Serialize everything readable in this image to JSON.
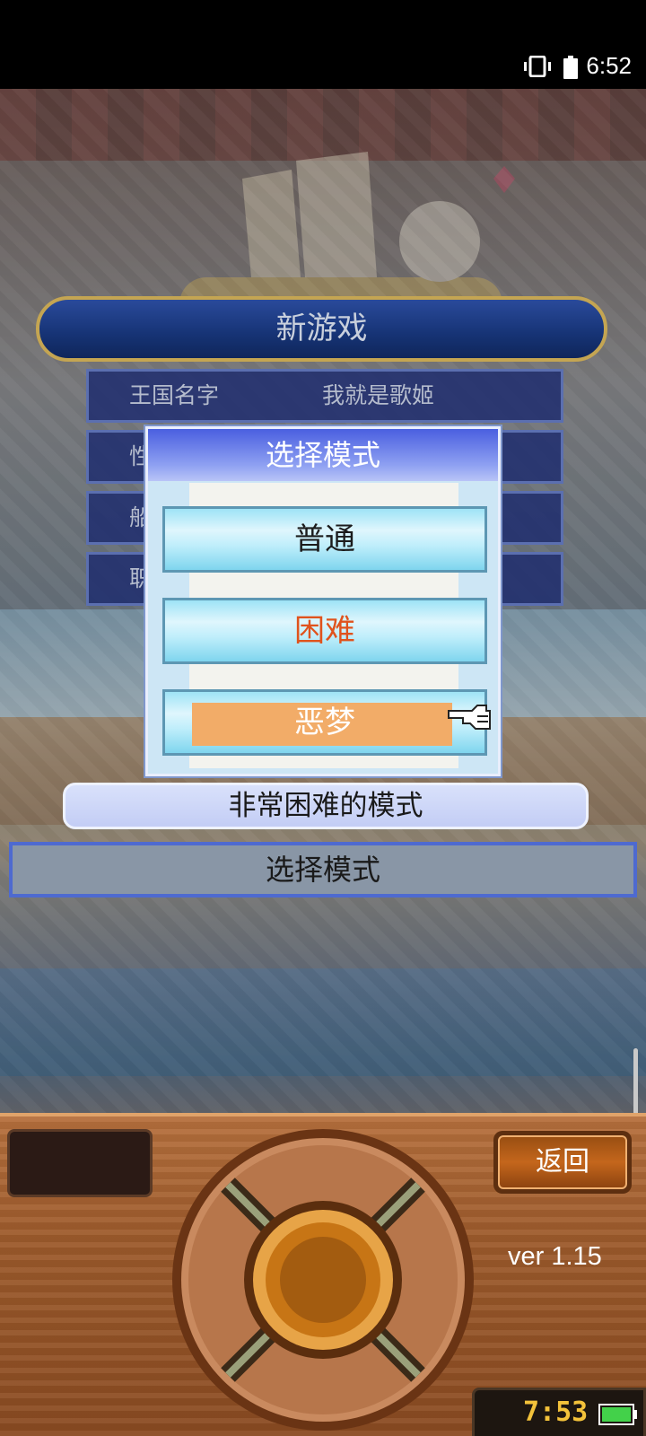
{
  "status_bar": {
    "time": "6:52"
  },
  "new_game": {
    "title": "新游戏",
    "rows": [
      {
        "label": "王国名字",
        "value": "我就是歌姬"
      },
      {
        "label": "性",
        "value": ""
      },
      {
        "label": "船",
        "value": ""
      },
      {
        "label": "职",
        "value": ""
      }
    ]
  },
  "mode_dialog": {
    "title": "选择模式",
    "options": [
      {
        "label": "普通",
        "state": "normal"
      },
      {
        "label": "困难",
        "state": "hard"
      },
      {
        "label": "恶梦",
        "state": "selected"
      }
    ]
  },
  "description": "非常困难的模式",
  "footer": "选择模式",
  "console": {
    "back_label": "返回",
    "version": "ver 1.15",
    "clock": "7:53"
  },
  "colors": {
    "accent_hard": "#e0531d",
    "selected_highlight": "#f2ac68",
    "dialog_title": "#4a5fe0"
  }
}
